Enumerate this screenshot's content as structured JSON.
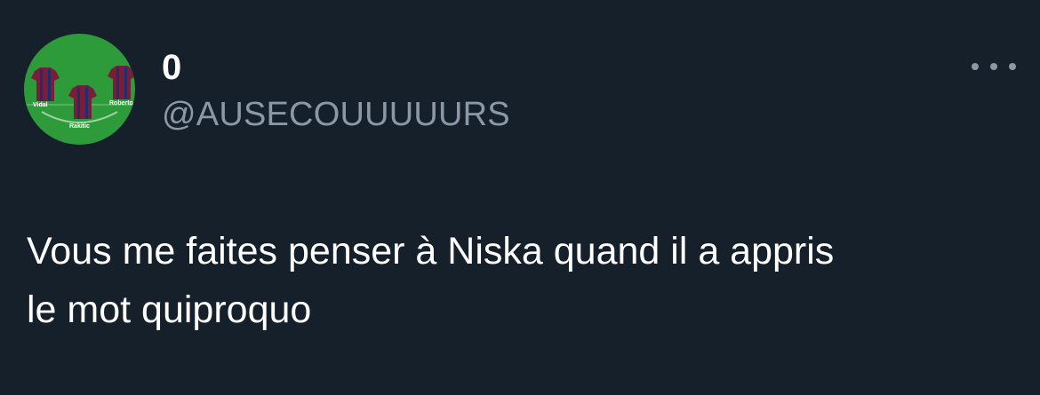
{
  "user": {
    "display_name": "0",
    "handle": "@AUSECOUUUUURS",
    "avatar": {
      "description_icon": "football-lineup-icon",
      "players": [
        "Vidal",
        "Roberto",
        "Rakitic"
      ],
      "pitch_color": "#2e9b3a",
      "jersey_colors": [
        "#7a1d3b",
        "#1f2f6e"
      ]
    }
  },
  "menu": {
    "icon": "more-horizontal-icon"
  },
  "tweet": {
    "lines": [
      "Vous me faites penser à Niska quand il a appris",
      "le mot quiproquo"
    ]
  },
  "colors": {
    "background": "#15202b",
    "text_primary": "#ffffff",
    "text_secondary": "#8b98a5"
  }
}
